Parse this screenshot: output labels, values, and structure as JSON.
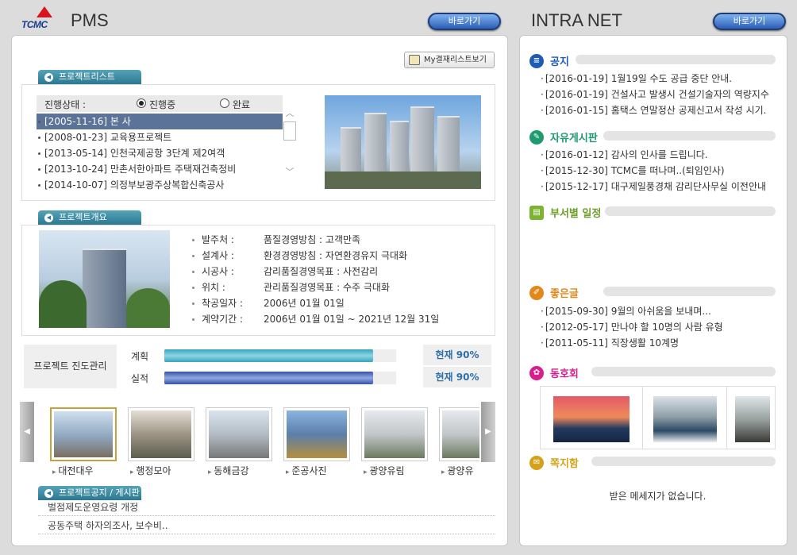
{
  "header": {
    "logo_text": "TCMC",
    "app_title": "PMS",
    "go_label": "바로가기",
    "intranet_title": "INTRA NET",
    "intranet_go_label": "바로가기"
  },
  "project_list": {
    "my_approval_btn": "My결재리스트보기",
    "tab_label": "프로젝트리스트",
    "status_label": "진행상태 :",
    "radio_in_progress": "진행중",
    "radio_done": "완료",
    "items": [
      {
        "text": "[2005-11-16] 본 사",
        "selected": true
      },
      {
        "text": "[2008-01-23] 교육용프로젝트",
        "selected": false
      },
      {
        "text": "[2013-05-14] 인천국제공항 3단계 제2여객",
        "selected": false
      },
      {
        "text": "[2013-10-24] 만촌서한아파트 주택재건축정비",
        "selected": false
      },
      {
        "text": "[2014-10-07] 의정부보광주상복합신축공사",
        "selected": false
      }
    ]
  },
  "overview": {
    "tab_label": "프로젝트개요",
    "rows": [
      {
        "label": "발주처 :",
        "value": "품질경영방침 : 고객만족"
      },
      {
        "label": "설계사 :",
        "value": "환경경영방침 : 자연환경유지 극대화"
      },
      {
        "label": "시공사 :",
        "value": "감리품질경영목표 : 사전감리"
      },
      {
        "label": "위치 :",
        "value": "관리품질경영목표 : 수주 극대화"
      },
      {
        "label": "착공일자 :",
        "value": "2006년 01월 01일"
      },
      {
        "label": "계약기간 :",
        "value": "2006년 01월 01일 ~ 2021년 12월 31일"
      }
    ]
  },
  "progress": {
    "title": "프로젝트 진도관리",
    "plan_label": "계획",
    "actual_label": "실적",
    "plan_text": "현재 90%",
    "actual_text": "현재 90%",
    "plan_value": 0.9,
    "actual_value": 0.9,
    "plan_color": "#35a6bc",
    "actual_color": "#3553a8"
  },
  "gallery": {
    "items": [
      "대전대우",
      "행정모아",
      "동해금강",
      "준공사진",
      "광양유림",
      "광양유"
    ]
  },
  "board": {
    "tab_label": "프로젝트공지 / 게시판",
    "items": [
      "벌점제도운영요령 개정",
      "공동주택 하자의조사, 보수비.."
    ]
  },
  "intranet": {
    "notice": {
      "title": "공지",
      "color": "#1e5bb5",
      "items": [
        "[2016-01-19] 1월19일 수도 공급 중단 안내.",
        "[2016-01-19] 건설사고 발생시 건설기술자의 역량지수",
        "[2016-01-15] 홈택스 연말정산 공제신고서 작성 시기."
      ]
    },
    "free": {
      "title": "자유게시판",
      "color": "#1e9a6e",
      "items": [
        "[2016-01-12] 감사의 인사를 드립니다.",
        "[2015-12-30] TCMC를 떠나며..(퇴임인사)",
        "[2015-12-17] 대구제일풍경채 감리단사무실 이전안내"
      ]
    },
    "schedule": {
      "title": "부서별 일정",
      "color": "#7cb431"
    },
    "good": {
      "title": "좋은글",
      "color": "#e0881a",
      "items": [
        "[2015-09-30] 9월의 아쉬움을 보내며...",
        "[2012-05-17] 만나야 할 10명의 사람 유형",
        "[2011-05-11] 직장생활 10계명"
      ]
    },
    "club": {
      "title": "동호회",
      "color": "#d81f8c"
    },
    "memo": {
      "title": "쪽지함",
      "color": "#d4a21a",
      "empty_text": "받은 메세지가 없습니다."
    }
  }
}
